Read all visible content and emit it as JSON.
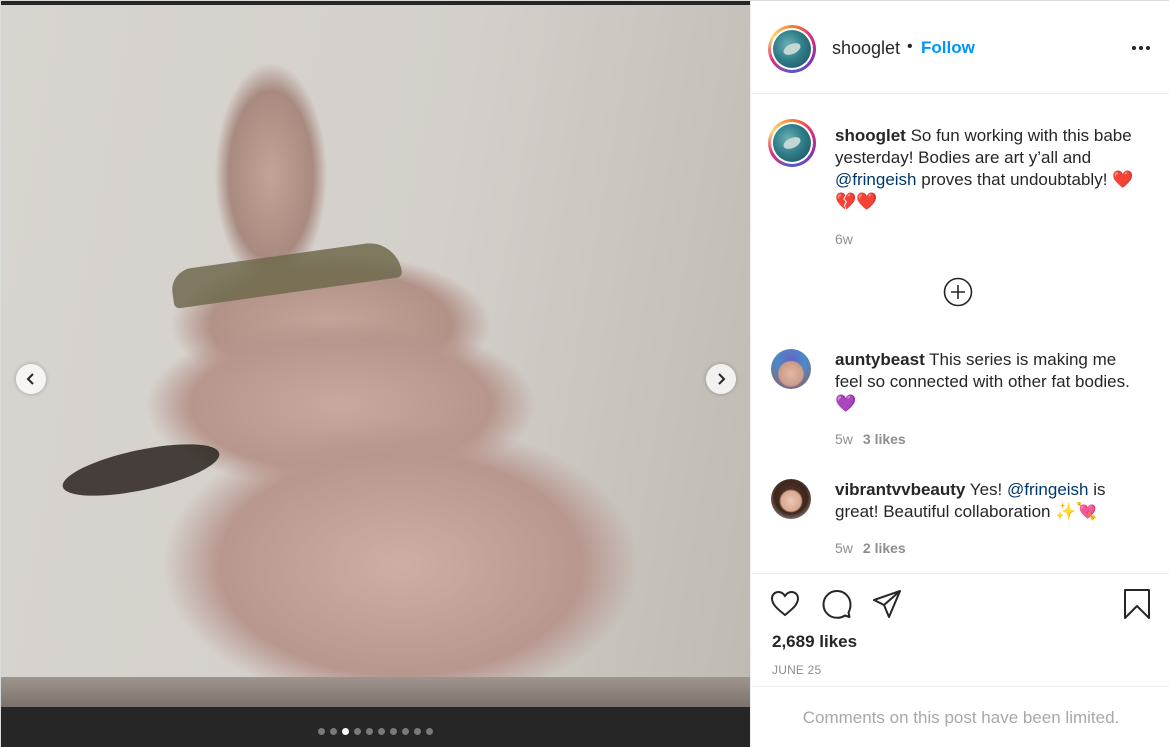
{
  "post": {
    "carousel": {
      "dot_count": 10,
      "active_index": 2
    },
    "header": {
      "username": "shooglet",
      "separator": "•",
      "follow_label": "Follow"
    },
    "caption": {
      "username": "shooglet",
      "text_before": " So fun working with this babe yesterday! Bodies are art y’all and ",
      "mention": "@fringeish",
      "text_after": " proves that undoubtably! ❤️💔❤️",
      "time": "6w"
    },
    "comments": [
      {
        "username": "auntybeast",
        "text_before": " This series is making me feel so connected with other fat bodies.",
        "emoji": "💜",
        "time": "5w",
        "likes": "3 likes"
      },
      {
        "username": "vibrantvvbeauty",
        "text_before": " Yes! ",
        "mention": "@fringeish",
        "text_after": " is great! Beautiful collaboration ✨💘",
        "time": "5w",
        "likes": "2 likes"
      }
    ],
    "likes_label": "2,689 likes",
    "date_label": "JUNE 25",
    "comments_limited": "Comments on this post have been limited.",
    "colors": {
      "follow": "#0095f6",
      "mention": "#00376b",
      "meta": "#8e8e8e"
    },
    "icons": [
      "chevron-left-icon",
      "chevron-right-icon",
      "more-icon",
      "add-circle-icon",
      "heart-icon",
      "comment-icon",
      "share-icon",
      "bookmark-icon"
    ]
  }
}
